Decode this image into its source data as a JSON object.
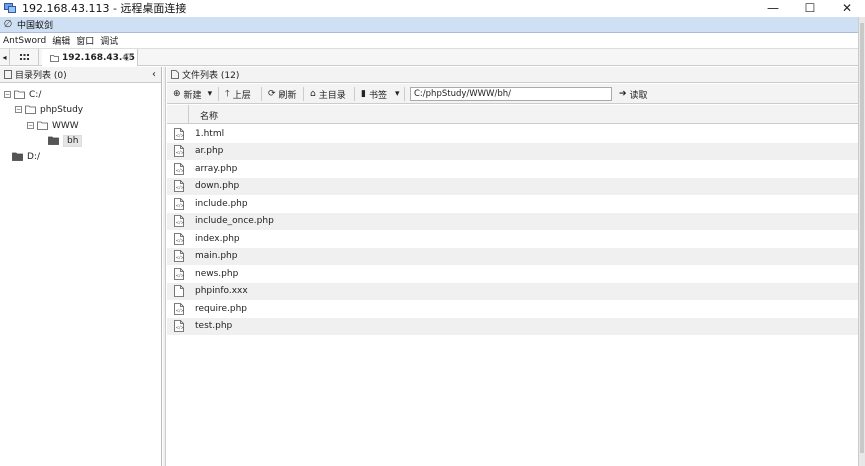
{
  "window": {
    "title": "192.168.43.113 - 远程桌面连接",
    "minimize_glyph": "—",
    "maximize_glyph": "☐",
    "close_glyph": "✕"
  },
  "app": {
    "title": "中国蚁剑",
    "menu": [
      "AntSword",
      "编辑",
      "窗口",
      "调试"
    ]
  },
  "tabs": [
    {
      "label": "192.168.43.45",
      "icon": "folder-icon"
    }
  ],
  "tree_panel": {
    "title": "目录列表 (0)",
    "nodes": [
      {
        "label": "C:/",
        "level": 0,
        "toggle": "−",
        "selected": false
      },
      {
        "label": "phpStudy",
        "level": 1,
        "toggle": "−",
        "selected": false
      },
      {
        "label": "WWW",
        "level": 2,
        "toggle": "−",
        "selected": false
      },
      {
        "label": "bh",
        "level": 3,
        "toggle": "",
        "selected": true
      },
      {
        "label": "D:/",
        "level": 0,
        "toggle": "",
        "selected": false
      }
    ]
  },
  "file_panel": {
    "title": "文件列表 (12)",
    "toolbar": {
      "new": "新建",
      "up": "上层",
      "refresh": "刷新",
      "home": "主目录",
      "bookmark": "书签",
      "path": "C:/phpStudy/WWW/bh/",
      "read": "读取"
    },
    "column_name": "名称",
    "files": [
      {
        "name": "1.html",
        "icon": "code-file-icon"
      },
      {
        "name": "ar.php",
        "icon": "code-file-icon"
      },
      {
        "name": "array.php",
        "icon": "code-file-icon"
      },
      {
        "name": "down.php",
        "icon": "code-file-icon"
      },
      {
        "name": "include.php",
        "icon": "code-file-icon"
      },
      {
        "name": "include_once.php",
        "icon": "code-file-icon"
      },
      {
        "name": "index.php",
        "icon": "code-file-icon"
      },
      {
        "name": "main.php",
        "icon": "code-file-icon"
      },
      {
        "name": "news.php",
        "icon": "code-file-icon"
      },
      {
        "name": "phpinfo.xxx",
        "icon": "blank-file-icon"
      },
      {
        "name": "require.php",
        "icon": "code-file-icon"
      },
      {
        "name": "test.php",
        "icon": "code-file-icon"
      }
    ]
  }
}
